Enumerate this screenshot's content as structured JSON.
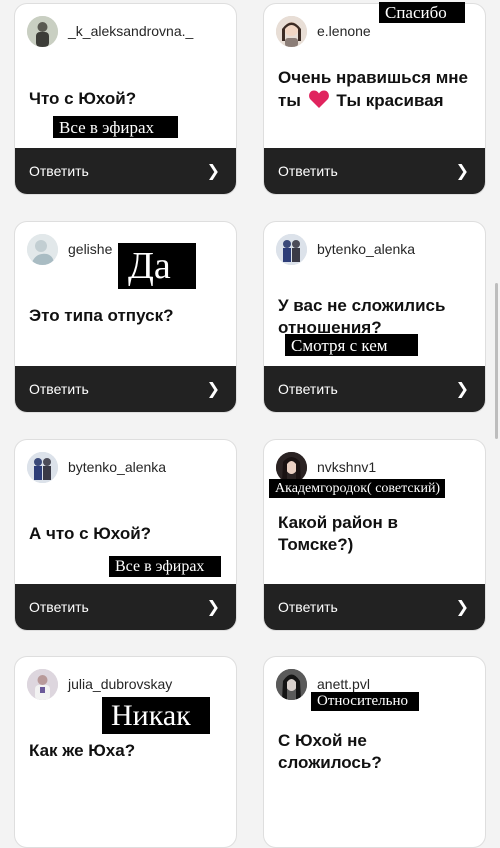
{
  "reply_label": "Ответить",
  "cards": [
    {
      "username": "_k_aleksandrovna._",
      "question": "Что с Юхой?",
      "sticker": "Все в эфирах"
    },
    {
      "username": "e.lenone",
      "question_before_heart": "Очень нравишься мне ты",
      "question_after_heart": "Ты красивая",
      "sticker": "Спасибо"
    },
    {
      "username": "gelishe",
      "question": "Это типа отпуск?",
      "sticker": "Да"
    },
    {
      "username": "bytenko_alenka",
      "question": "У вас не сложились отношения?",
      "sticker": "Смотря с кем"
    },
    {
      "username": "bytenko_alenka",
      "question": "А что с Юхой?",
      "sticker": "Все в эфирах"
    },
    {
      "username": "nvkshnv1",
      "question": "Какой район в Томске?)",
      "sticker": "Академгородок( советский)"
    },
    {
      "username": "julia_dubrovskay",
      "question": "Как же Юха?",
      "sticker": "Никак"
    },
    {
      "username": "anett.pvl",
      "question": "С Юхой не сложилось?",
      "sticker": "Относительно"
    }
  ],
  "icons": {
    "reply_arrow": "chevron-right-icon",
    "heart": "red-heart-icon"
  },
  "colors": {
    "reply_bar": "#222222",
    "heart": "#e0245e",
    "background": "#f3f3f3"
  }
}
